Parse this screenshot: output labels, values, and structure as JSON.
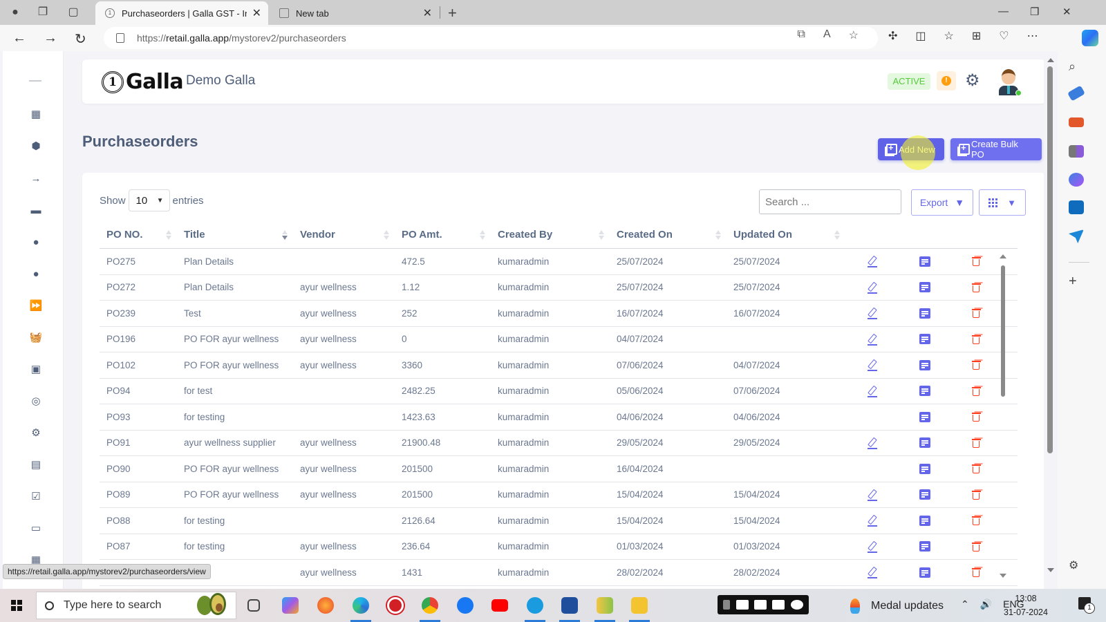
{
  "browser": {
    "tabs": [
      {
        "label": "Purchaseorders | Galla GST - Inve",
        "active": true
      },
      {
        "label": "New tab",
        "active": false
      }
    ],
    "url_scheme": "https://",
    "url_host": "retail.galla.app",
    "url_path": "/mystorev2/purchaseorders",
    "status_url": "https://retail.galla.app/mystorev2/purchaseorders/view"
  },
  "header": {
    "logo_text": "Galla",
    "logo_mark": "1",
    "store_name": "Demo Galla",
    "status_badge": "ACTIVE",
    "alert_symbol": "!",
    "colors": {
      "accent": "#5f61e6",
      "active_badge_bg": "#e4f8df",
      "active_badge_text": "#56ca3b",
      "alert": "#ff9f0f",
      "danger": "#ff3e1d"
    }
  },
  "page": {
    "title": "Purchaseorders",
    "add_new_label": "Add New",
    "bulk_po_label": "Create Bulk PO"
  },
  "table_controls": {
    "show_label": "Show",
    "entries_label": "entries",
    "page_size": "10",
    "search_placeholder": "Search ...",
    "export_label": "Export"
  },
  "table": {
    "columns": [
      "PO NO.",
      "Title",
      "Vendor",
      "PO Amt.",
      "Created By",
      "Created On",
      "Updated On"
    ],
    "rows": [
      {
        "po": "PO275",
        "title": "Plan Details",
        "vendor": "",
        "amount": "472.5",
        "created_by": "kumaradmin",
        "created_on": "25/07/2024",
        "updated_on": "25/07/2024",
        "editable": true
      },
      {
        "po": "PO272",
        "title": "Plan Details",
        "vendor": "ayur wellness",
        "amount": "1.12",
        "created_by": "kumaradmin",
        "created_on": "25/07/2024",
        "updated_on": "25/07/2024",
        "editable": true
      },
      {
        "po": "PO239",
        "title": "Test",
        "vendor": "ayur wellness",
        "amount": "252",
        "created_by": "kumaradmin",
        "created_on": "16/07/2024",
        "updated_on": "16/07/2024",
        "editable": true
      },
      {
        "po": "PO196",
        "title": "PO FOR ayur wellness",
        "vendor": "ayur wellness",
        "amount": "0",
        "created_by": "kumaradmin",
        "created_on": "04/07/2024",
        "updated_on": "",
        "editable": true
      },
      {
        "po": "PO102",
        "title": "PO FOR ayur wellness",
        "vendor": "ayur wellness",
        "amount": "3360",
        "created_by": "kumaradmin",
        "created_on": "07/06/2024",
        "updated_on": "04/07/2024",
        "editable": true
      },
      {
        "po": "PO94",
        "title": "for test",
        "vendor": "",
        "amount": "2482.25",
        "created_by": "kumaradmin",
        "created_on": "05/06/2024",
        "updated_on": "07/06/2024",
        "editable": true
      },
      {
        "po": "PO93",
        "title": "for testing",
        "vendor": "",
        "amount": "1423.63",
        "created_by": "kumaradmin",
        "created_on": "04/06/2024",
        "updated_on": "04/06/2024",
        "editable": false
      },
      {
        "po": "PO91",
        "title": "ayur wellness supplier",
        "vendor": "ayur wellness",
        "amount": "21900.48",
        "created_by": "kumaradmin",
        "created_on": "29/05/2024",
        "updated_on": "29/05/2024",
        "editable": true
      },
      {
        "po": "PO90",
        "title": "PO FOR ayur wellness",
        "vendor": "ayur wellness",
        "amount": "201500",
        "created_by": "kumaradmin",
        "created_on": "16/04/2024",
        "updated_on": "",
        "editable": false
      },
      {
        "po": "PO89",
        "title": "PO FOR ayur wellness",
        "vendor": "ayur wellness",
        "amount": "201500",
        "created_by": "kumaradmin",
        "created_on": "15/04/2024",
        "updated_on": "15/04/2024",
        "editable": true
      },
      {
        "po": "PO88",
        "title": "for testing",
        "vendor": "",
        "amount": "2126.64",
        "created_by": "kumaradmin",
        "created_on": "15/04/2024",
        "updated_on": "15/04/2024",
        "editable": true
      },
      {
        "po": "PO87",
        "title": "for testing",
        "vendor": "ayur wellness",
        "amount": "236.64",
        "created_by": "kumaradmin",
        "created_on": "01/03/2024",
        "updated_on": "01/03/2024",
        "editable": true
      },
      {
        "po": "",
        "title": "ng",
        "vendor": "ayur wellness",
        "amount": "1431",
        "created_by": "kumaradmin",
        "created_on": "28/02/2024",
        "updated_on": "28/02/2024",
        "editable": true
      }
    ]
  },
  "sidebar": {
    "icons": [
      "menu-collapse",
      "dashboard",
      "box",
      "arrow-right",
      "discount-ticket",
      "user-circle",
      "user-circle",
      "fast-forward",
      "basket",
      "contacts",
      "location",
      "settings",
      "report",
      "checkbox",
      "cash",
      "calendar"
    ]
  },
  "taskbar": {
    "search_placeholder": "Type here to search",
    "medal_label": "Medal updates",
    "language": "ENG",
    "time": "13:08",
    "date": "31-07-2024",
    "notification_count": "1"
  }
}
